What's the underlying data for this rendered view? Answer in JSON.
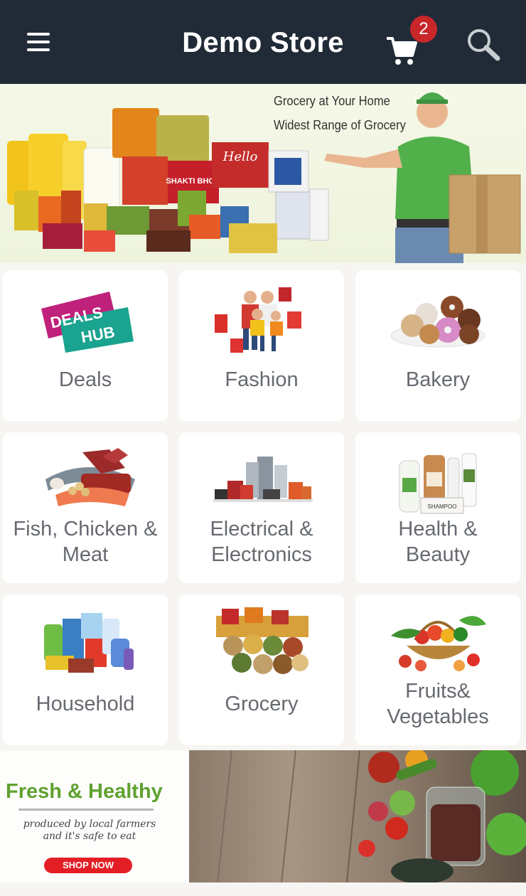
{
  "header": {
    "title": "Demo Store",
    "cart_count": "2",
    "icons": {
      "menu": "hamburger-menu-icon",
      "cart": "shopping-cart-icon",
      "search": "search-icon"
    },
    "colors": {
      "bar": "#212b38",
      "badge": "#c9262a"
    }
  },
  "hero": {
    "line1": "Grocery at Your Home",
    "line2": "Widest Range of Grocery",
    "logo_text": [
      "Hello",
      "SHAKTI BHOG",
      "DEALS",
      "HUB"
    ]
  },
  "categories": [
    {
      "label": "Deals"
    },
    {
      "label": "Fashion"
    },
    {
      "label": "Bakery"
    },
    {
      "label": "Fish, Chicken &\nMeat"
    },
    {
      "label": "Electrical &\nElectronics"
    },
    {
      "label": "Health &\nBeauty"
    },
    {
      "label": "Household"
    },
    {
      "label": "Grocery"
    },
    {
      "label": "Fruits&\nVegetables"
    }
  ],
  "promo": {
    "title": "Fresh & Healthy",
    "subtitle1": "produced by local farmers",
    "subtitle2": "and it's safe to eat",
    "cta": "SHOP NOW",
    "colors": {
      "title": "#5fa130",
      "cta": "#e31e25"
    }
  }
}
